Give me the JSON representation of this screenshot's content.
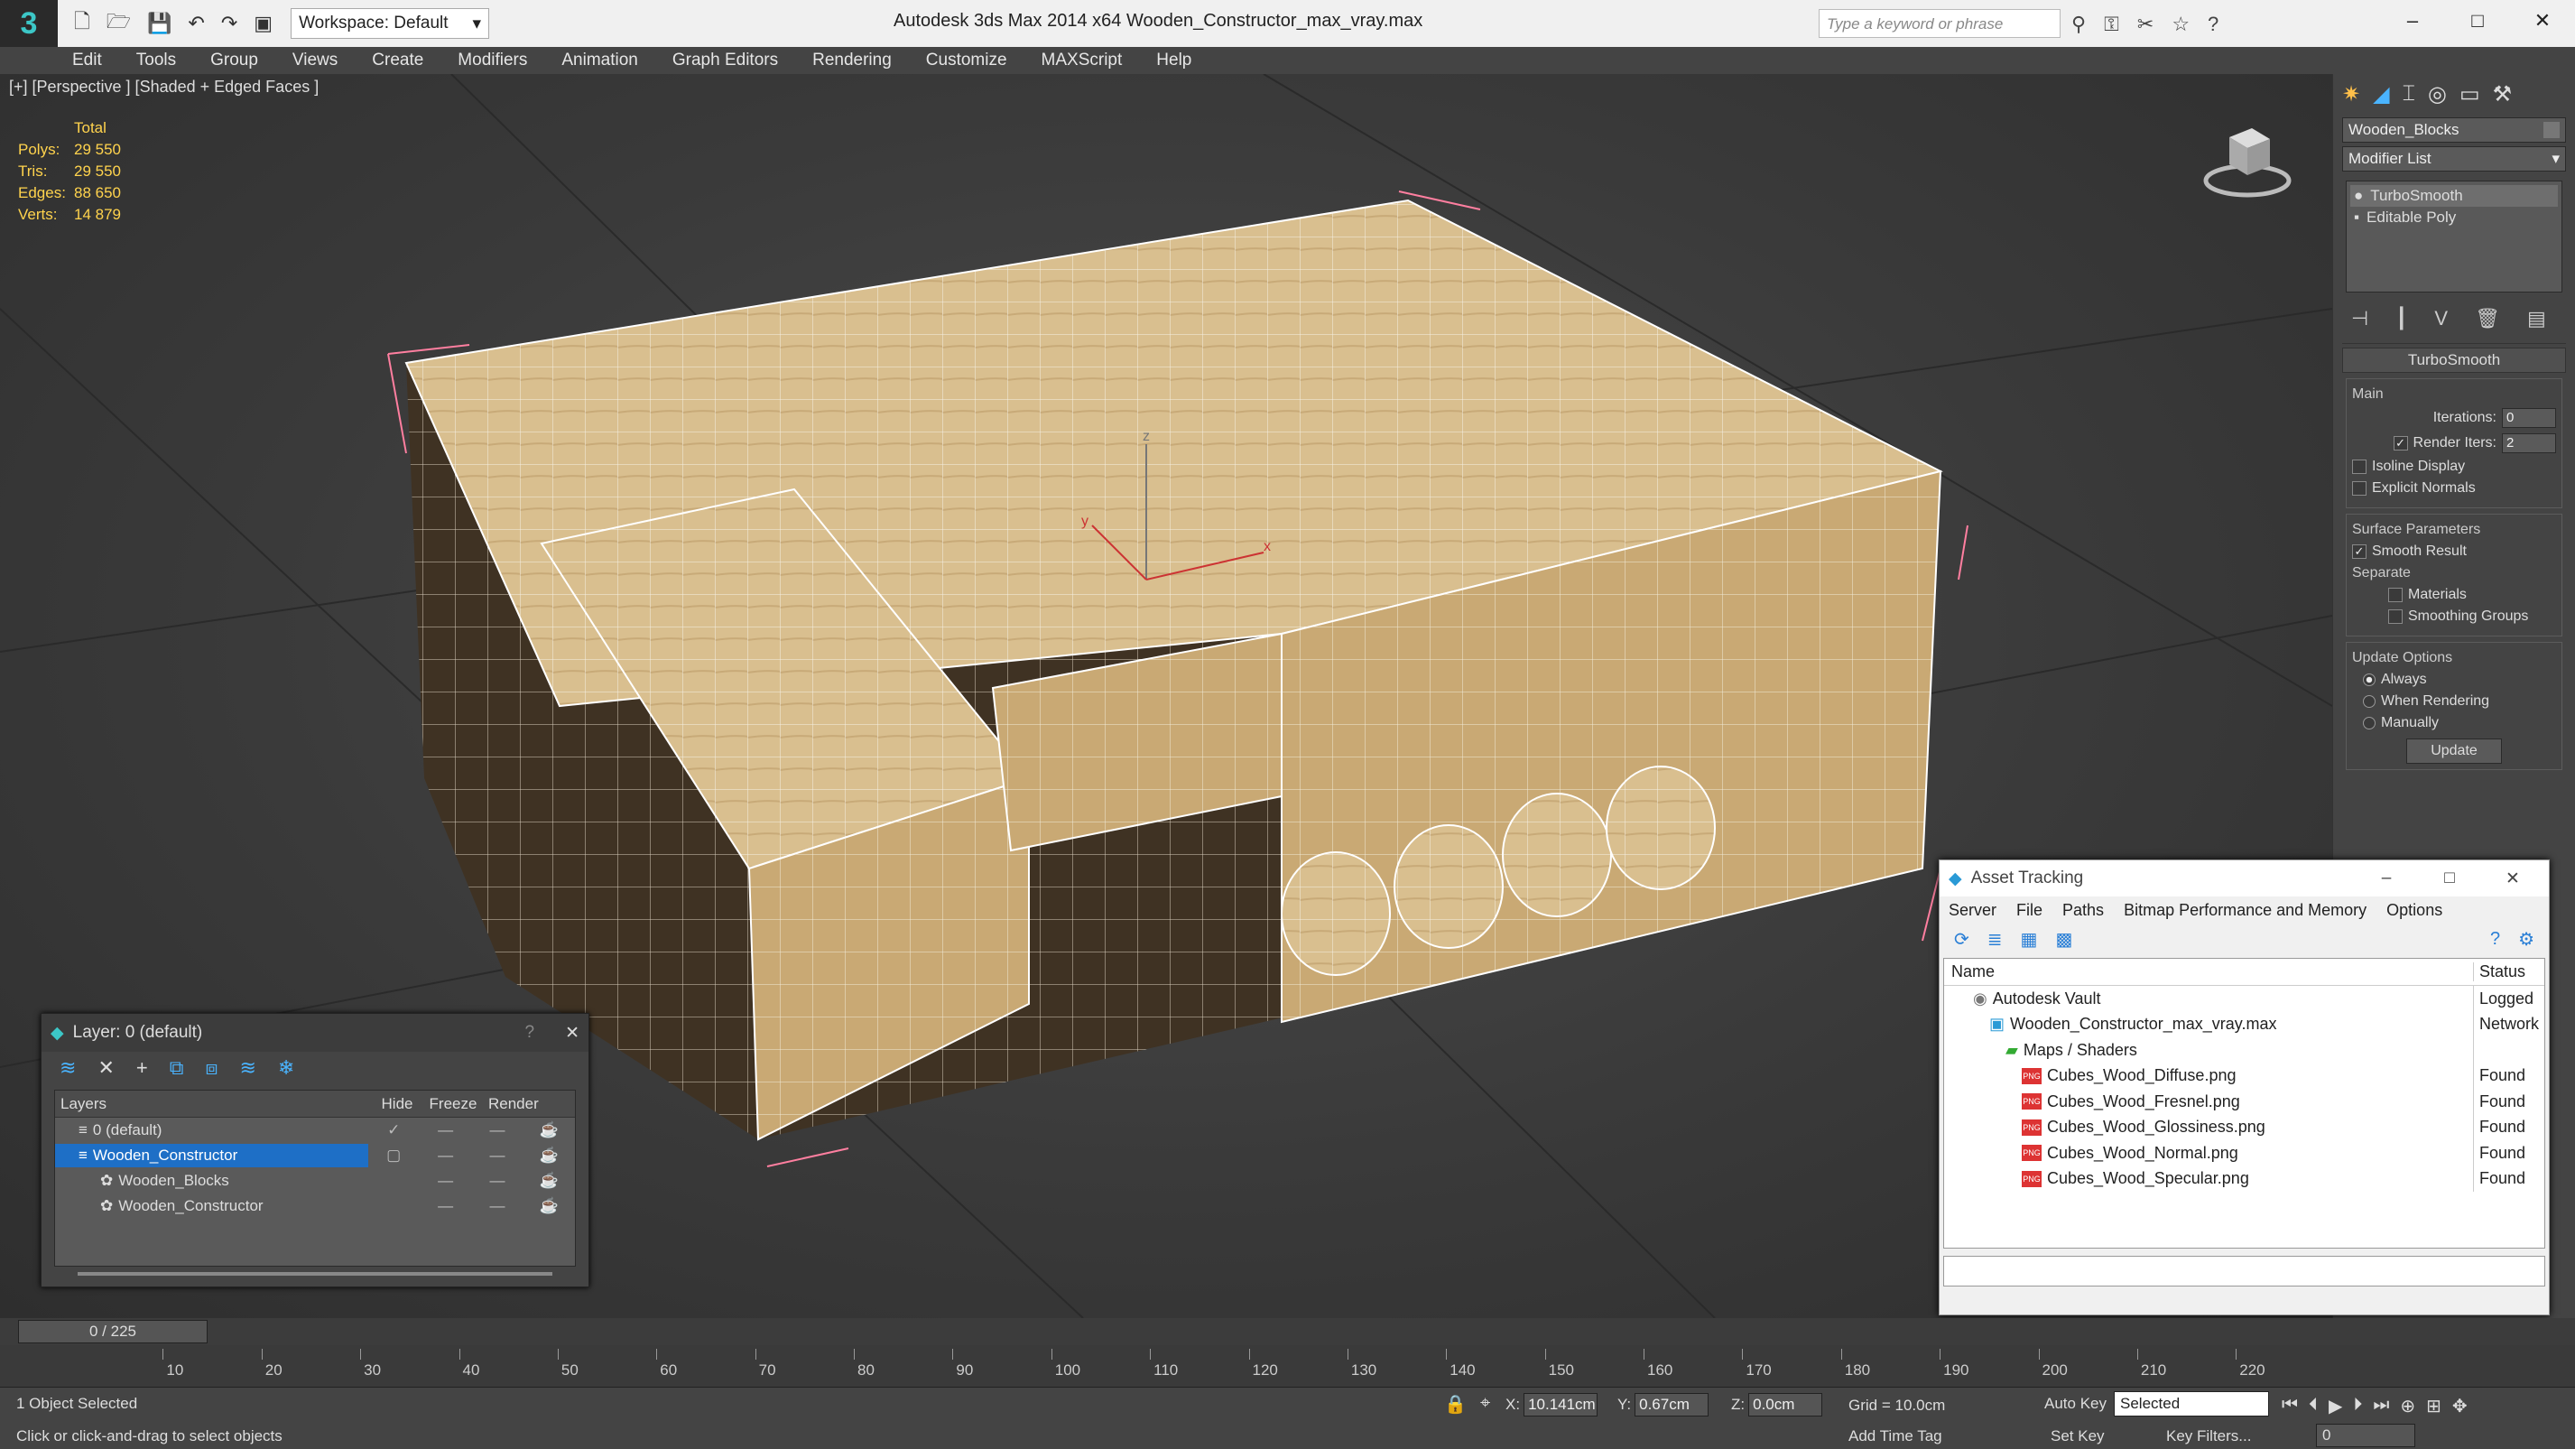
{
  "app": {
    "logo": "3",
    "title": "Autodesk 3ds Max  2014 x64      Wooden_Constructor_max_vray.max",
    "workspace": "Workspace: Default",
    "search_placeholder": "Type a keyword or phrase",
    "win_min": "–",
    "win_max": "□",
    "win_close": "✕"
  },
  "menu": [
    "Edit",
    "Tools",
    "Group",
    "Views",
    "Create",
    "Modifiers",
    "Animation",
    "Graph Editors",
    "Rendering",
    "Customize",
    "MAXScript",
    "Help"
  ],
  "viewport": {
    "label": "[+] [Perspective ] [Shaded + Edged Faces ]",
    "stats": {
      "header": "Total",
      "rows": [
        {
          "k": "Polys:",
          "v": "29 550"
        },
        {
          "k": "Tris:",
          "v": "29 550"
        },
        {
          "k": "Edges:",
          "v": "88 650"
        },
        {
          "k": "Verts:",
          "v": "14 879"
        }
      ]
    },
    "gizmo": {
      "x": "x",
      "y": "y",
      "z": "z"
    }
  },
  "command_panel": {
    "object_name": "Wooden_Blocks",
    "modifier_list": "Modifier List",
    "stack": [
      "TurboSmooth",
      "Editable Poly"
    ],
    "rollout_title": "TurboSmooth",
    "main_label": "Main",
    "iterations_label": "Iterations:",
    "iterations": "0",
    "render_iters_label": "Render Iters:",
    "render_iters": "2",
    "isoline": "Isoline Display",
    "explicit": "Explicit Normals",
    "surface_params": "Surface Parameters",
    "smooth_result": "Smooth Result",
    "separate": "Separate",
    "materials": "Materials",
    "smoothing_groups": "Smoothing Groups",
    "update_options": "Update Options",
    "always": "Always",
    "when_rendering": "When Rendering",
    "manually": "Manually",
    "update_btn": "Update"
  },
  "layer_window": {
    "title": "Layer: 0 (default)",
    "help": "?",
    "close": "✕",
    "cols": {
      "layers": "Layers",
      "hide": "Hide",
      "freeze": "Freeze",
      "render": "Render"
    },
    "rows": [
      {
        "name": "0 (default)"
      },
      {
        "name": "Wooden_Constructor"
      },
      {
        "name": "Wooden_Blocks"
      },
      {
        "name": "Wooden_Constructor"
      }
    ],
    "check": "✓",
    "dash": "—"
  },
  "asset_window": {
    "title": "Asset Tracking",
    "menu": [
      "Server",
      "File",
      "Paths",
      "Bitmap Performance and Memory",
      "Options"
    ],
    "cols": {
      "name": "Name",
      "status": "Status"
    },
    "rows": [
      {
        "name": "Autodesk Vault",
        "status": "Logged"
      },
      {
        "name": "Wooden_Constructor_max_vray.max",
        "status": "Network"
      },
      {
        "name": "Maps / Shaders",
        "status": ""
      },
      {
        "name": "Cubes_Wood_Diffuse.png",
        "status": "Found"
      },
      {
        "name": "Cubes_Wood_Fresnel.png",
        "status": "Found"
      },
      {
        "name": "Cubes_Wood_Glossiness.png",
        "status": "Found"
      },
      {
        "name": "Cubes_Wood_Normal.png",
        "status": "Found"
      },
      {
        "name": "Cubes_Wood_Specular.png",
        "status": "Found"
      }
    ],
    "png": "PNG"
  },
  "timeline": {
    "slider": "0 / 225",
    "ticks": [
      "10",
      "20",
      "30",
      "40",
      "50",
      "60",
      "70",
      "80",
      "90",
      "100",
      "110",
      "120",
      "130",
      "140",
      "150",
      "160",
      "170",
      "180",
      "190",
      "200",
      "210",
      "220"
    ]
  },
  "status": {
    "selected": "1 Object Selected",
    "hint": "Click or click-and-drag to select objects",
    "x_label": "X:",
    "x": "10.141cm",
    "y_label": "Y:",
    "y": "0.67cm",
    "z_label": "Z:",
    "z": "0.0cm",
    "grid": "Grid = 10.0cm",
    "add_time_tag": "Add Time Tag",
    "auto_key": "Auto Key",
    "set_key": "Set Key",
    "selected_dropdown": "Selected",
    "key_filters": "Key Filters...",
    "frame": "0"
  }
}
